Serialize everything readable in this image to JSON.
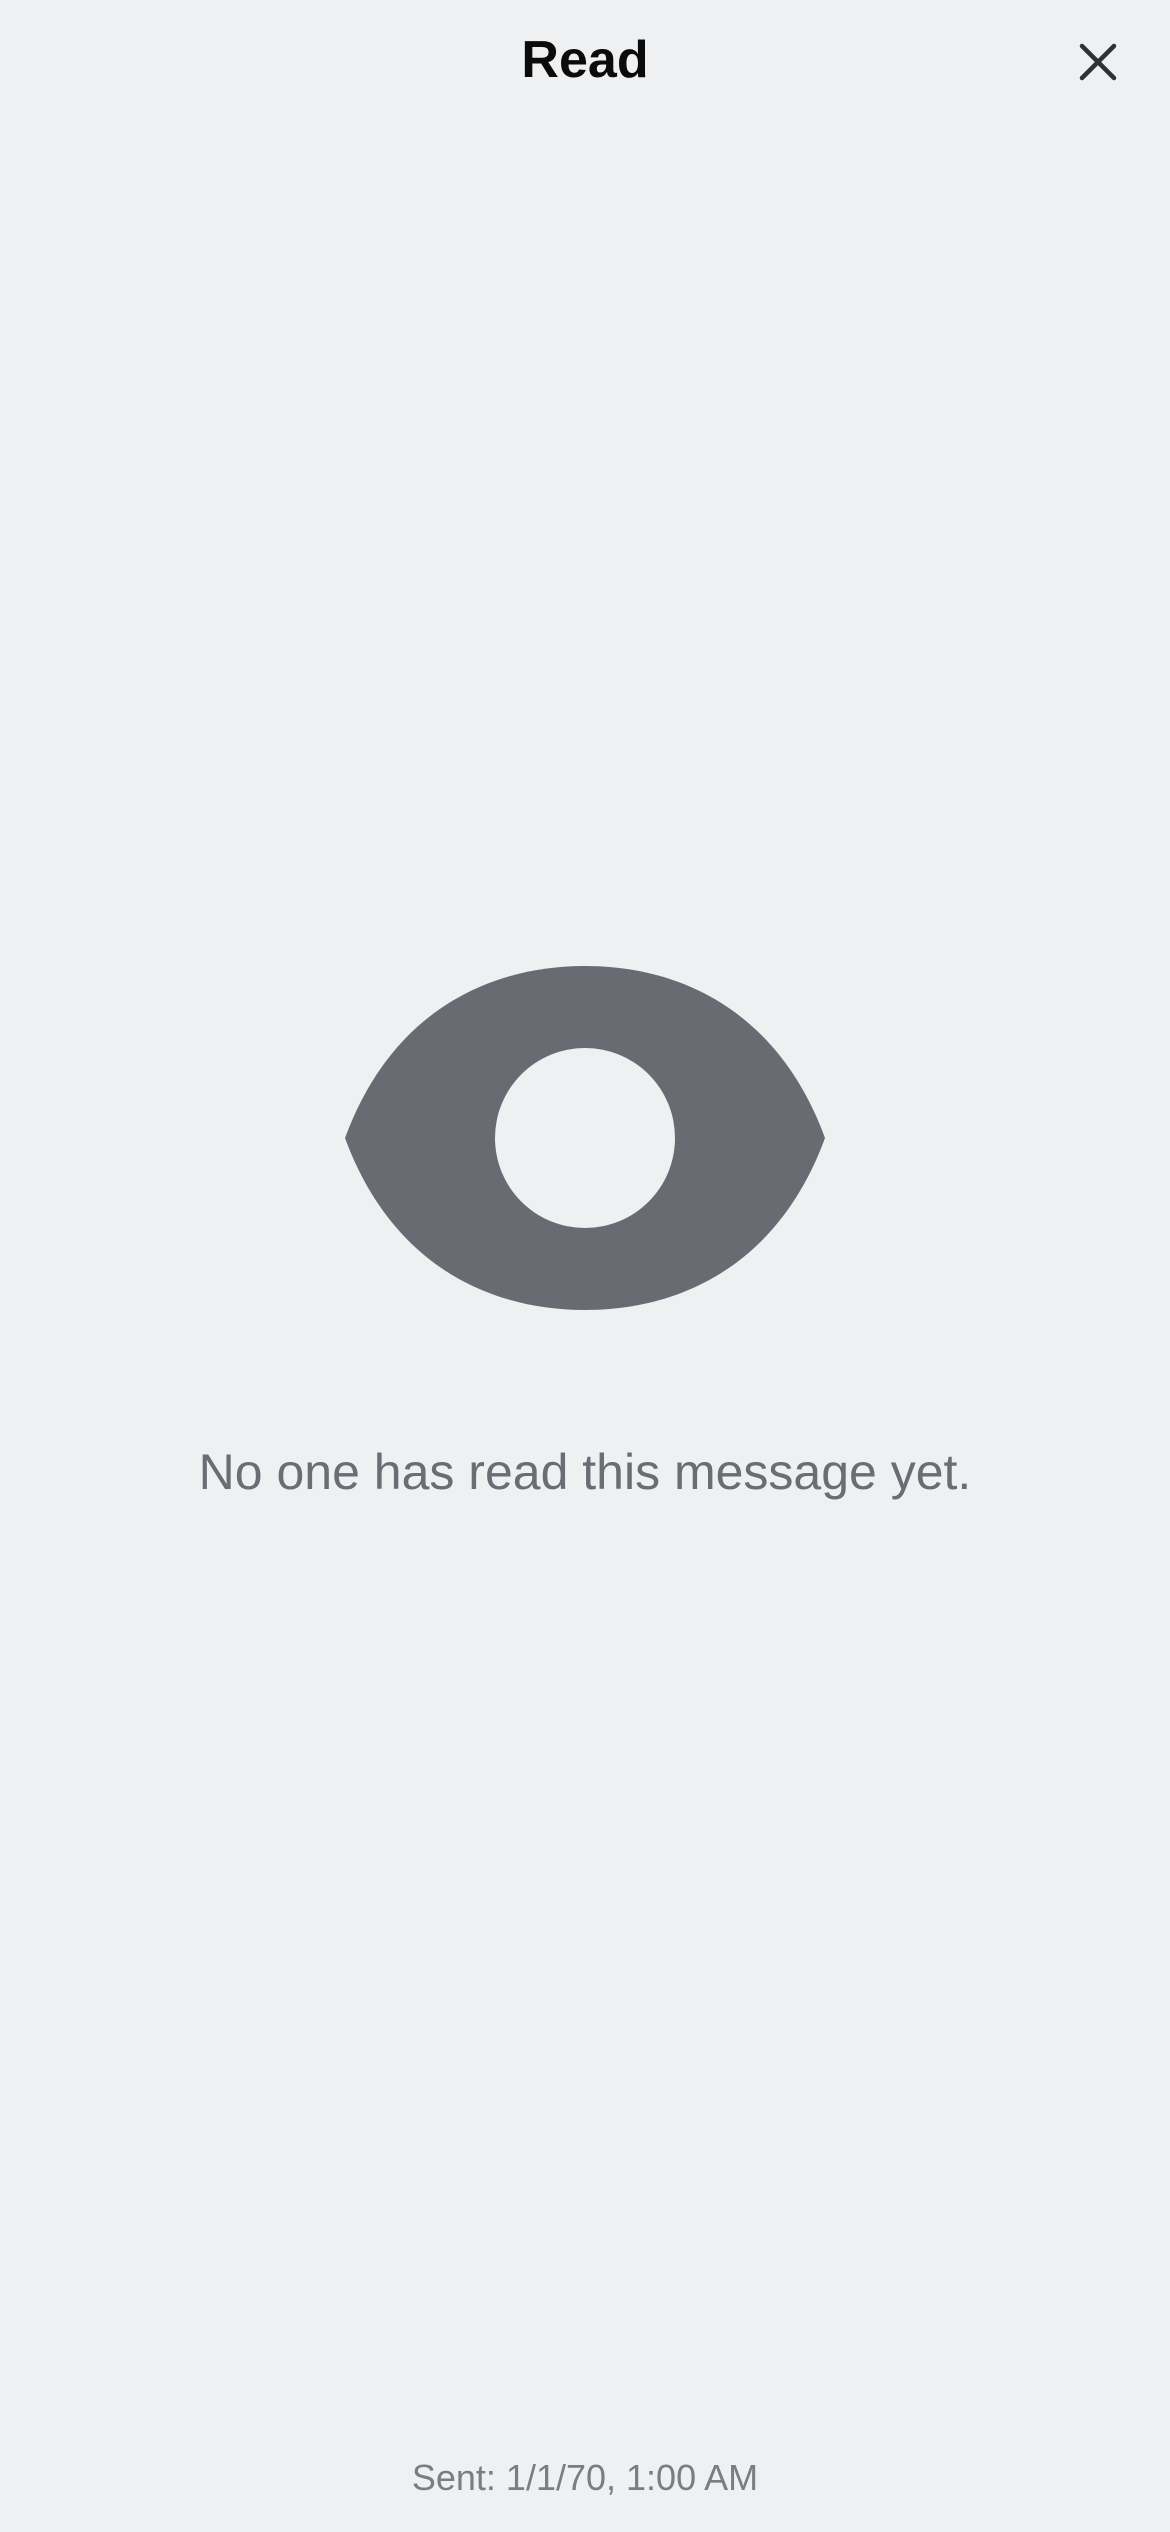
{
  "header": {
    "title": "Read",
    "close_icon": "close-icon"
  },
  "empty_state": {
    "icon": "eye-icon",
    "message": "No one has read this message yet."
  },
  "footer": {
    "sent_text": "Sent: 1/1/70, 1:00 AM"
  },
  "colors": {
    "background": "#eff0f2",
    "title": "#0b0b0c",
    "icon": "#686b72",
    "message": "#6a6d74",
    "footer_text": "#7a7d83",
    "close_icon": "#2f3136"
  }
}
